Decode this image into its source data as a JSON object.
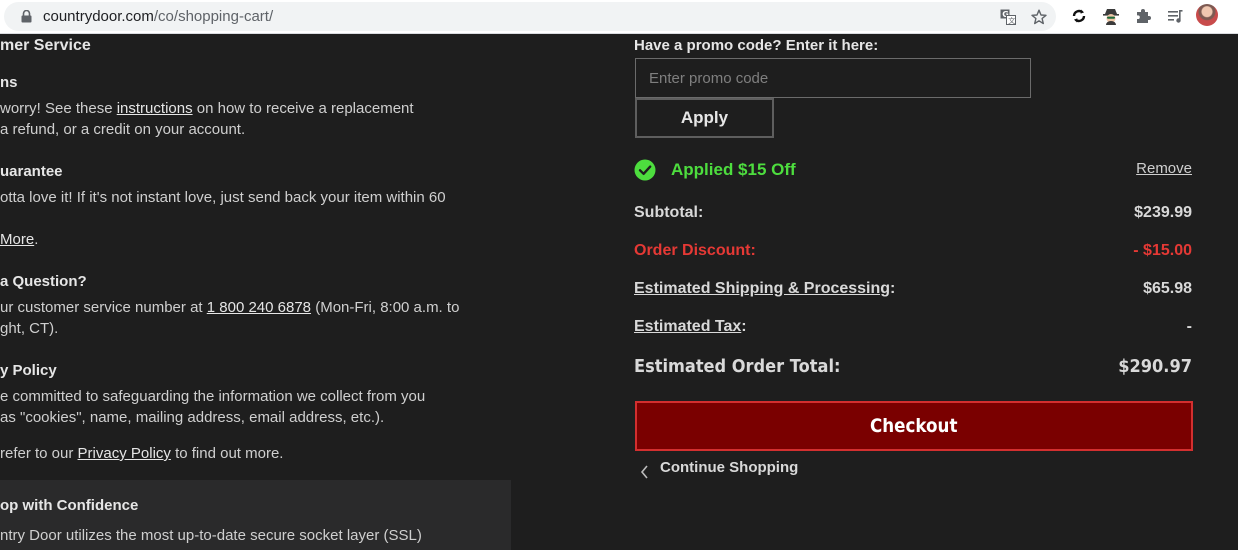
{
  "browser": {
    "url_host": "countrydoor.com",
    "url_path": "/co/shopping-cart/",
    "icons": [
      "lock-icon",
      "translate-icon",
      "star-icon",
      "sync-icon",
      "incognito-icon",
      "puzzle-icon",
      "media-icon",
      "avatar"
    ]
  },
  "left": {
    "customer_service_heading": "mer Service",
    "returns_heading": "ns",
    "returns_line1_pre": " worry! See these ",
    "returns_link": "instructions",
    "returns_line1_post": " on how to receive a replacement",
    "returns_line2": "a refund, or a credit on your account.",
    "guarantee_heading": "uarantee",
    "guarantee_line1": "otta love it! If it's not instant love, just send back your item within 60",
    "learn_more_link": "More",
    "learn_more_suffix": ".",
    "question_heading": "a Question?",
    "question_line1_pre": "ur customer service number at ",
    "phone_link": "1 800 240 6878",
    "question_line1_post": " (Mon-Fri, 8:00 a.m. to",
    "question_line2": "ght, CT).",
    "privacy_heading": "y Policy",
    "privacy_line1": "e committed to safeguarding the information we collect from you",
    "privacy_line2": "as \"cookies\", name, mailing address, email address, etc.).",
    "privacy_line3_pre": " refer to our ",
    "privacy_link": "Privacy Policy",
    "privacy_line3_post": " to find out more.",
    "confidence_heading": "op with Confidence",
    "confidence_line1": "ntry Door utilizes the most up-to-date secure socket layer (SSL)"
  },
  "cart": {
    "promo_label": "Have a promo code? Enter it here:",
    "promo_placeholder": "Enter promo code",
    "promo_value": "",
    "apply_label": "Apply",
    "applied_text": "Applied $15 Off",
    "remove_label": "Remove",
    "subtotal_label": "Subtotal:",
    "subtotal_value": "$239.99",
    "discount_label": "Order Discount:",
    "discount_value": "- $15.00",
    "shipping_label": "Estimated Shipping & Processing",
    "shipping_colon": ":",
    "shipping_value": "$65.98",
    "tax_label": "Estimated Tax",
    "tax_colon": ":",
    "tax_value": "-",
    "total_label": "Estimated Order Total:",
    "total_value": "$290.97",
    "checkout_label": "Checkout",
    "continue_label": "Continue Shopping"
  },
  "colors": {
    "background": "#1e1e1e",
    "accent_red": "#e53935",
    "checkout_bg": "#7a0000",
    "success_green": "#4ddd3e"
  }
}
